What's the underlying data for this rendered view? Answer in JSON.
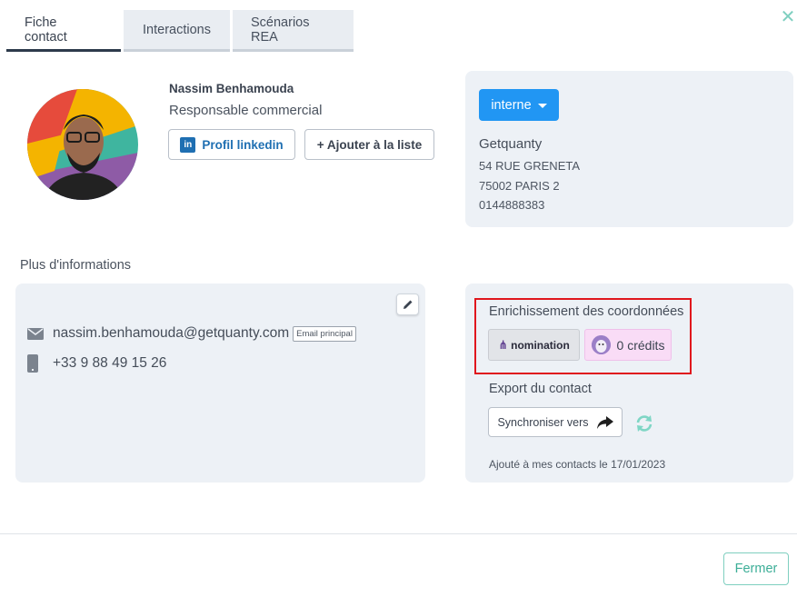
{
  "tabs": [
    {
      "label": "Fiche contact"
    },
    {
      "label": "Interactions"
    },
    {
      "label": "Scénarios REA"
    }
  ],
  "close_icon": "close-x-icon",
  "contact": {
    "name": "Nassim Benhamouda",
    "role": "Responsable commercial",
    "linkedin_label": "Profil linkedin",
    "linkedin_icon": "in",
    "add_list_label": "+ Ajouter à la liste"
  },
  "company": {
    "type_label": "interne",
    "name": "Getquanty",
    "address_line1": "54 RUE GRENETA",
    "address_line2": "75002 PARIS 2",
    "phone": "0144888383"
  },
  "more_info": {
    "label": "Plus d'informations",
    "email": "nassim.benhamouda@getquanty.com",
    "email_badge": "Email principal",
    "phone": "+33 9 88 49 15 26"
  },
  "enrichment": {
    "title": "Enrichissement des coordonnées",
    "provider_label": "nomination",
    "credits_label": "0 crédits"
  },
  "export": {
    "title": "Export du contact",
    "sync_label": "Synchroniser vers",
    "added_text": "Ajouté à mes contacts le 17/01/2023"
  },
  "footer": {
    "close_label": "Fermer"
  },
  "colors": {
    "accent_blue": "#2196f3",
    "accent_teal": "#3cae97",
    "highlight_red": "#e0161d",
    "card_bg": "#edf1f6"
  }
}
